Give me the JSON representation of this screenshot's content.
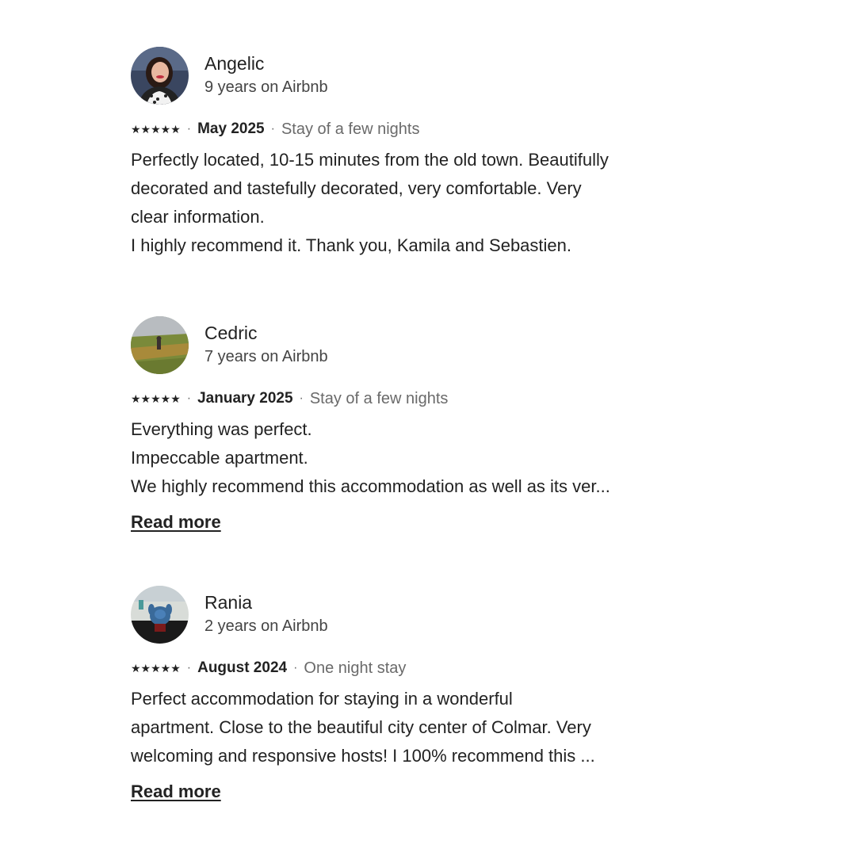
{
  "reviews": [
    {
      "name": "Angelic",
      "tenure": "9 years on Airbnb",
      "rating": 5,
      "stars": "★★★★★",
      "separator": "·",
      "date": "May 2025",
      "stay": "Stay of a few nights",
      "lines": [
        "Perfectly located, 10-15 minutes from the old town. Beautifully",
        "decorated and tastefully decorated, very comfortable. Very",
        "clear information.",
        "I highly recommend it. Thank you, Kamila and Sebastien."
      ]
    },
    {
      "name": "Cedric",
      "tenure": "7 years on Airbnb",
      "rating": 5,
      "stars": "★★★★★",
      "separator": "·",
      "date": "January 2025",
      "stay": "Stay of a few nights",
      "lines": [
        "Everything was perfect.",
        "Impeccable apartment.",
        "We highly recommend this accommodation as well as its ver..."
      ],
      "read_more": "Read more"
    },
    {
      "name": "Rania",
      "tenure": "2 years on Airbnb",
      "rating": 5,
      "stars": "★★★★★",
      "separator": "·",
      "date": "August 2024",
      "stay": "One night stay",
      "lines": [
        "Perfect accommodation for staying in a wonderful",
        "apartment. Close to the beautiful city center of Colmar. Very",
        "welcoming and responsive hosts! I 100% recommend this ..."
      ],
      "read_more": "Read more"
    }
  ]
}
